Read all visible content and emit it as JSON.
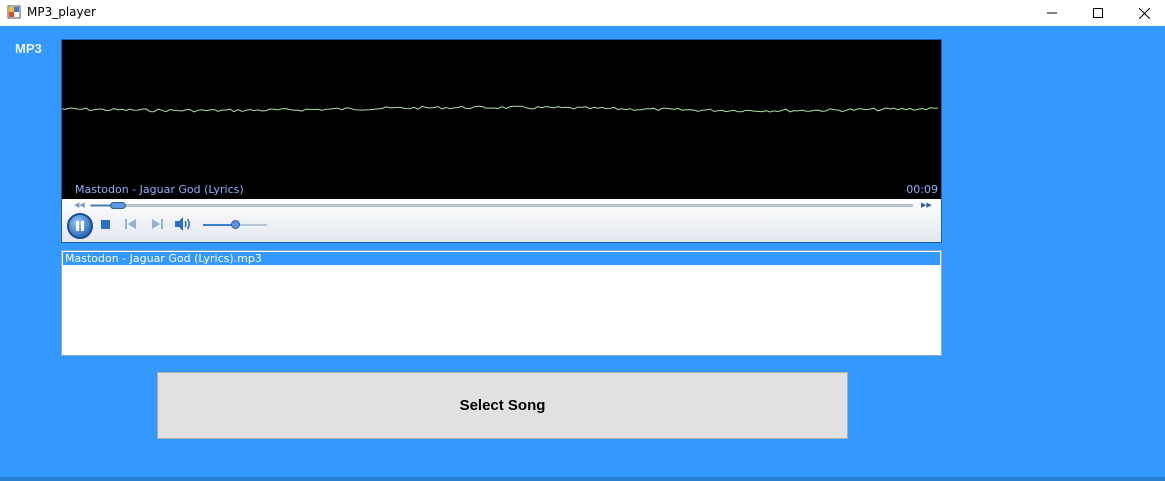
{
  "window": {
    "title": "MP3_player",
    "controls": {
      "minimize": "minimize",
      "maximize": "maximize",
      "close": "close"
    }
  },
  "app": {
    "label": "MP3"
  },
  "player": {
    "now_playing": "Mastodon - Jaguar God (Lyrics)",
    "time": "00:09",
    "seek_progress": 0.03,
    "volume_level": 0.5,
    "state": "playing"
  },
  "playlist": {
    "items": [
      {
        "label": "Mastodon - Jaguar God (Lyrics).mp3",
        "selected": true
      }
    ]
  },
  "buttons": {
    "select_song": "Select Song"
  },
  "colors": {
    "background": "#3399ff",
    "visualizer_line": "#a8e6a0",
    "selection": "#3399ff"
  }
}
